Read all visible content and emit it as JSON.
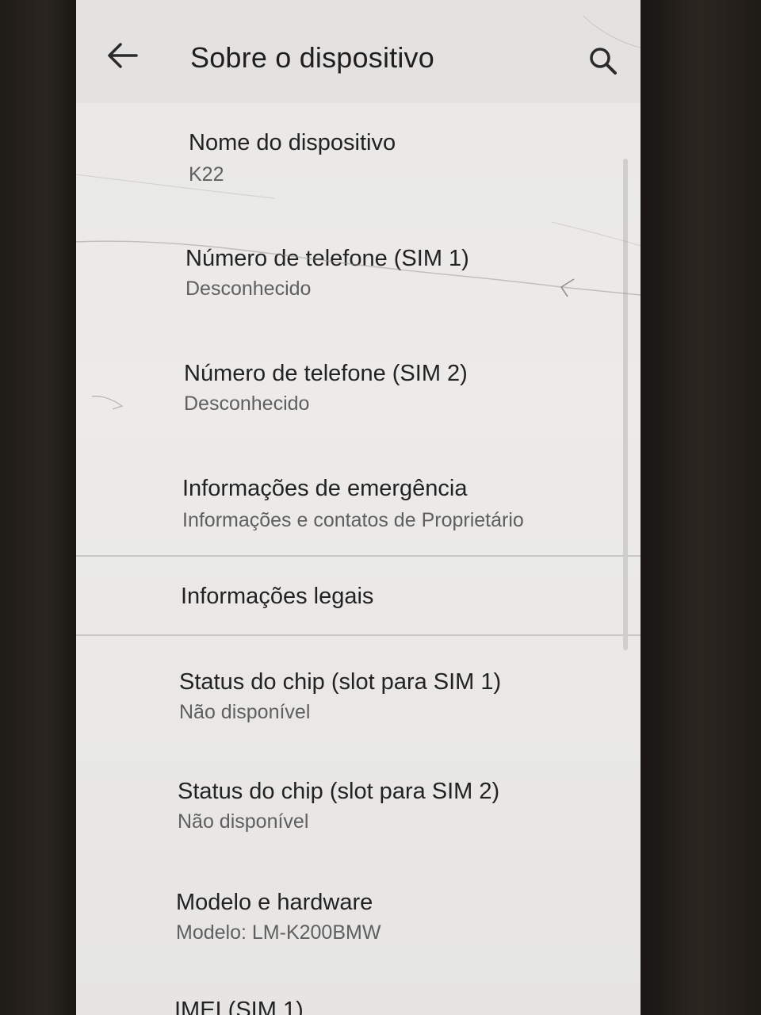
{
  "app_bar": {
    "title": "Sobre o dispositivo",
    "back_icon": "arrow-back-icon",
    "search_icon": "search-icon"
  },
  "items": [
    {
      "title": "Nome do dispositivo",
      "summary": "K22"
    },
    {
      "title": "Número de telefone (SIM 1)",
      "summary": "Desconhecido"
    },
    {
      "title": "Número de telefone (SIM 2)",
      "summary": "Desconhecido"
    },
    {
      "title": "Informações de emergência",
      "summary": "Informações e contatos de Proprietário"
    },
    {
      "title": "Informações legais"
    },
    {
      "title": "Status do chip (slot para SIM 1)",
      "summary": "Não disponível"
    },
    {
      "title": "Status do chip (slot para SIM 2)",
      "summary": "Não disponível"
    },
    {
      "title": "Modelo e hardware",
      "summary": "Modelo: LM-K200BMW"
    },
    {
      "title": "IMEI (SIM 1)"
    }
  ],
  "colors": {
    "screen_bg": "#ebeae8",
    "title_text": "#222222",
    "summary_text": "#5f5f5f",
    "divider": "#c8c7c5"
  }
}
